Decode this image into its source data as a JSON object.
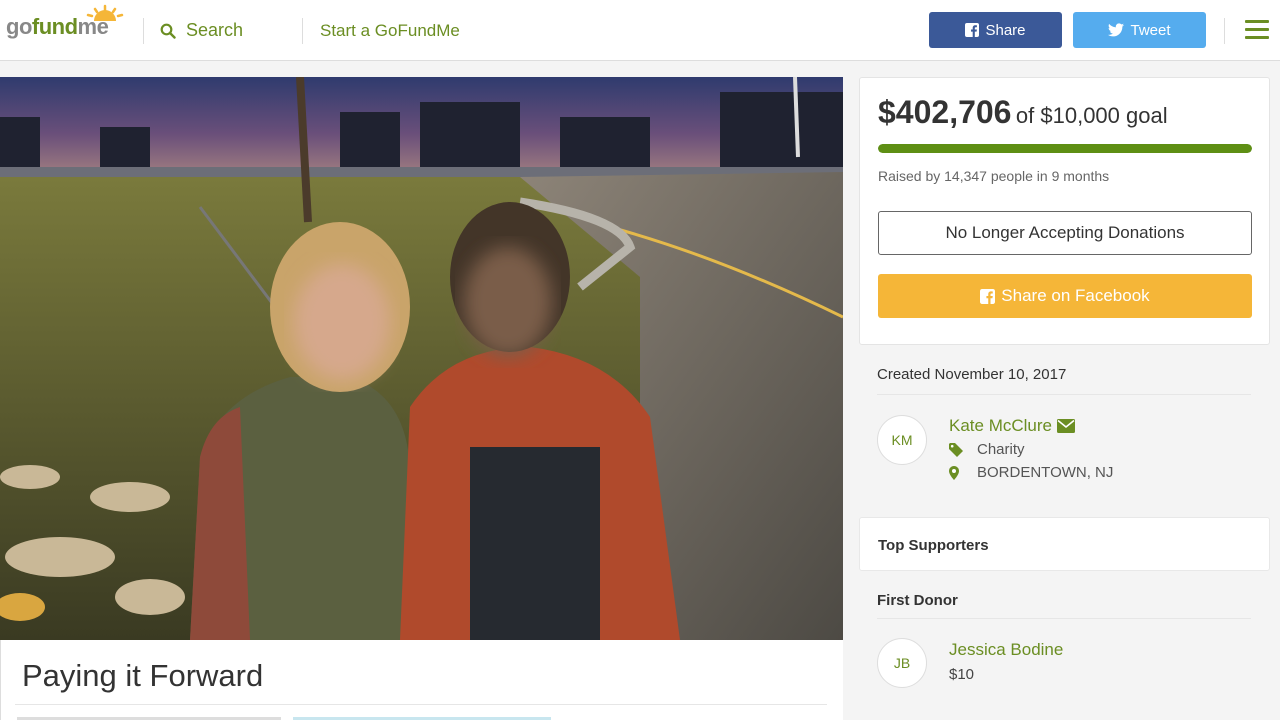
{
  "header": {
    "logo_part1": "go",
    "logo_part2": "fund",
    "logo_part3": "me",
    "search_label": "Search",
    "start_label": "Start a GoFundMe",
    "share_label": "Share",
    "tweet_label": "Tweet"
  },
  "campaign": {
    "title": "Paying it Forward"
  },
  "donation": {
    "amount": "$402,706",
    "goal_text": "of $10,000 goal",
    "progress_fraction": 1.0,
    "raised_text": "Raised by 14,347 people in 9 months",
    "status_button": "No Longer Accepting Donations",
    "facebook_button": "Share on Facebook"
  },
  "organizer": {
    "created": "Created November 10, 2017",
    "initials": "KM",
    "name": "Kate McClure",
    "category": "Charity",
    "location": "BORDENTOWN, NJ"
  },
  "supporters": {
    "top_label": "Top Supporters",
    "first_label": "First Donor",
    "donor_initials": "JB",
    "donor_name": "Jessica Bodine",
    "donor_amount": "$10"
  },
  "colors": {
    "brand_green": "#6b8e23",
    "progress_green": "#5e8f14",
    "facebook_blue": "#3b5998",
    "twitter_blue": "#55acee",
    "share_yellow": "#f5b638"
  }
}
